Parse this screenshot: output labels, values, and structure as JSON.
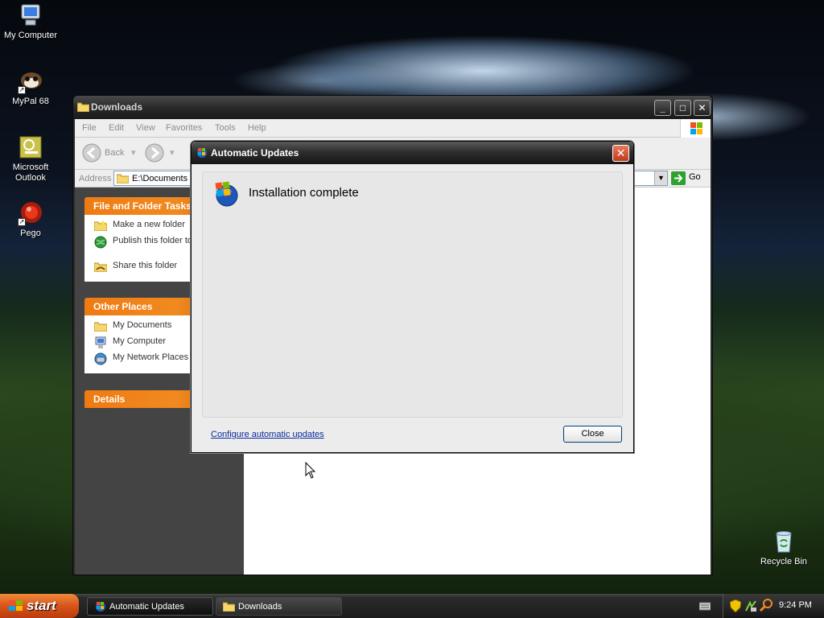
{
  "desktop": {
    "icons": [
      {
        "label": "My Computer",
        "icon": "computer-icon"
      },
      {
        "label": "MyPal 68",
        "icon": "mypal-browser-icon"
      },
      {
        "label": "Microsoft Outlook",
        "icon": "outlook-icon"
      },
      {
        "label": "Pego",
        "icon": "pego-icon"
      },
      {
        "label": "Recycle Bin",
        "icon": "recycle-bin-icon"
      }
    ]
  },
  "explorer": {
    "title": "Downloads",
    "menu": [
      "File",
      "Edit",
      "View",
      "Favorites",
      "Tools",
      "Help"
    ],
    "toolbar": {
      "back": "Back"
    },
    "address": {
      "label": "Address",
      "value": "E:\\Documents a",
      "go": "Go"
    },
    "file_tasks": {
      "title": "File and Folder Tasks",
      "items": [
        "Make a new folder",
        "Publish this folder to Web",
        "Share this folder"
      ]
    },
    "other_places": {
      "title": "Other Places",
      "items": [
        "My Documents",
        "My Computer",
        "My Network Places"
      ]
    },
    "details": {
      "title": "Details"
    }
  },
  "dialog": {
    "title": "Automatic Updates",
    "heading": "Installation complete",
    "link": "Configure automatic updates",
    "close_button": "Close"
  },
  "taskbar": {
    "start": "start",
    "buttons": [
      {
        "label": "Automatic Updates",
        "active": true
      },
      {
        "label": "Downloads",
        "active": false
      }
    ],
    "clock": "9:24 PM"
  }
}
